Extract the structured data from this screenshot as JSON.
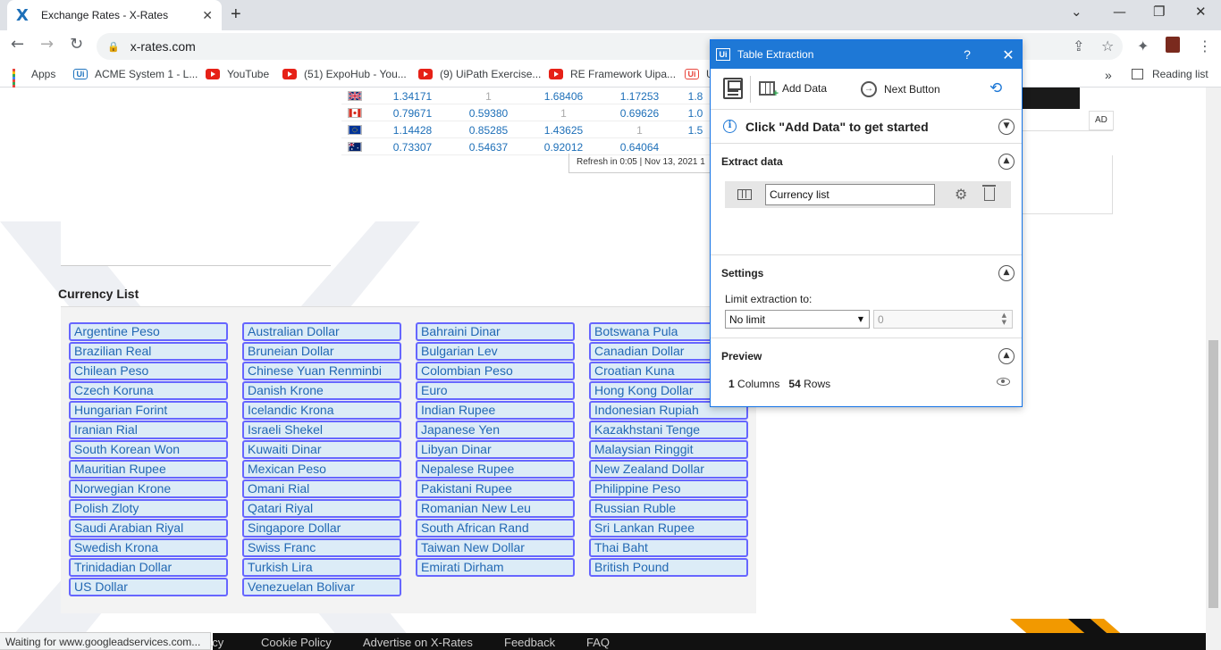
{
  "browser": {
    "tab_title": "Exchange Rates - X-Rates",
    "url": "x-rates.com",
    "status_text": "Waiting for www.googleadservices.com...",
    "bookmarks": [
      "Apps",
      "ACME System 1 - L...",
      "YouTube",
      "(51) ExpoHub - You...",
      "(9) UiPath Exercise...",
      "RE Framework Uipa...",
      "U"
    ],
    "reading_list": "Reading list",
    "more_bookmarks": "»"
  },
  "rates": {
    "rows": [
      {
        "flag": "uk",
        "values": [
          "1.34171",
          "1",
          "1.68406",
          "1.17253",
          "1.8"
        ]
      },
      {
        "flag": "ca",
        "values": [
          "0.79671",
          "0.59380",
          "1",
          "0.69626",
          "1.0"
        ]
      },
      {
        "flag": "eu",
        "values": [
          "1.14428",
          "0.85285",
          "1.43625",
          "1",
          "1.5"
        ]
      },
      {
        "flag": "au",
        "values": [
          "0.73307",
          "0.54637",
          "0.92012",
          "0.64064",
          ""
        ]
      }
    ],
    "refresh": "Refresh in 0:05 | Nov 13, 2021 1",
    "ad_label": "AD"
  },
  "currency_list": {
    "heading": "Currency List",
    "columns": [
      [
        "Argentine Peso",
        "Brazilian Real",
        "Chilean Peso",
        "Czech Koruna",
        "Hungarian Forint",
        "Iranian Rial",
        "South Korean Won",
        "Mauritian Rupee",
        "Norwegian Krone",
        "Polish Zloty",
        "Saudi Arabian Riyal",
        "Swedish Krona",
        "Trinidadian Dollar",
        "US Dollar"
      ],
      [
        "Australian Dollar",
        "Bruneian Dollar",
        "Chinese Yuan Renminbi",
        "Danish Krone",
        "Icelandic Krona",
        "Israeli Shekel",
        "Kuwaiti Dinar",
        "Mexican Peso",
        "Omani Rial",
        "Qatari Riyal",
        "Singapore Dollar",
        "Swiss Franc",
        "Turkish Lira",
        "Venezuelan Bolivar"
      ],
      [
        "Bahraini Dinar",
        "Bulgarian Lev",
        "Colombian Peso",
        "Euro",
        "Indian Rupee",
        "Japanese Yen",
        "Libyan Dinar",
        "Nepalese Rupee",
        "Pakistani Rupee",
        "Romanian New Leu",
        "South African Rand",
        "Taiwan New Dollar",
        "Emirati Dirham"
      ],
      [
        "Botswana Pula",
        "Canadian Dollar",
        "Croatian Kuna",
        "Hong Kong Dollar",
        "Indonesian Rupiah",
        "Kazakhstani Tenge",
        "Malaysian Ringgit",
        "New Zealand Dollar",
        "Philippine Peso",
        "Russian Ruble",
        "Sri Lankan Rupee",
        "Thai Baht",
        "British Pound"
      ]
    ]
  },
  "footer": {
    "links": [
      "acy",
      "Cookie Policy",
      "Advertise on X-Rates",
      "Feedback",
      "FAQ"
    ]
  },
  "dialog": {
    "title": "Table Extraction",
    "help": "?",
    "add_data": "Add Data",
    "next_button": "Next Button",
    "info_message": "Click \"Add Data\" to get started",
    "extract_title": "Extract data",
    "extract_name": "Currency list",
    "settings_title": "Settings",
    "limit_label": "Limit extraction to:",
    "limit_value": "No limit",
    "limit_number": "0",
    "preview_title": "Preview",
    "columns_count": "1",
    "columns_label": "Columns",
    "rows_count": "54",
    "rows_label": "Rows"
  },
  "colors": {
    "dialog_accent": "#1e78d6",
    "currency_border": "#6666ff",
    "currency_bg": "#dcecf7",
    "link_blue": "#2268b3"
  }
}
